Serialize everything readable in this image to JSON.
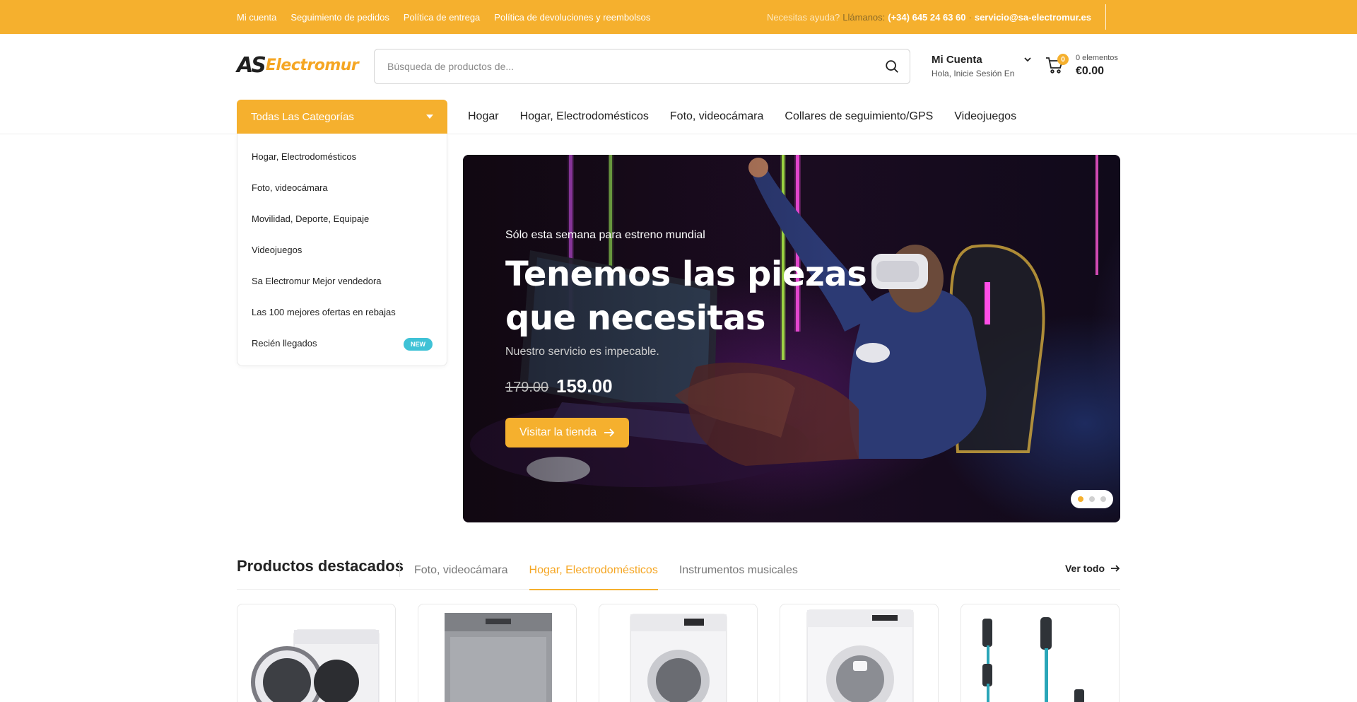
{
  "topbar": {
    "links": [
      "Mi cuenta",
      "Seguimiento de pedidos",
      "Política de entrega",
      "Política de devoluciones y reembolsos"
    ],
    "help_text": "Necesitas ayuda?",
    "call_text": "Llámanos:",
    "phone": "(+34) 645 24 63 60",
    "email": "servicio@sa-electromur.es"
  },
  "header": {
    "logo_mark": "AS",
    "logo_word": "Electromur",
    "search_placeholder": "Búsqueda de productos de...",
    "account_title": "Mi Cuenta",
    "account_sub": "Hola, Inicie Sesión En",
    "cart_count": "0",
    "cart_items": "0 elementos",
    "cart_total": "€0.00"
  },
  "nav": {
    "all_categories": "Todas Las Categorías",
    "items": [
      "Hogar",
      "Hogar, Electrodomésticos",
      "Foto, videocámara",
      "Collares de seguimiento/GPS",
      "Videojuegos"
    ]
  },
  "categories": [
    {
      "label": "Hogar, Electrodomésticos"
    },
    {
      "label": "Foto, videocámara"
    },
    {
      "label": "Movilidad, Deporte, Equipaje"
    },
    {
      "label": "Videojuegos"
    },
    {
      "label": "Sa Electromur Mejor vendedora"
    },
    {
      "label": "Las 100 mejores ofertas en rebajas"
    },
    {
      "label": "Recién llegados",
      "badge": "NEW"
    }
  ],
  "hero": {
    "pretitle": "Sólo esta semana para estreno mundial",
    "title": "Tenemos las piezas que necesitas",
    "subtitle": "Nuestro servicio es impecable.",
    "old_price": "179.00",
    "new_price": "159.00",
    "cta": "Visitar la tienda",
    "slides": 3,
    "active_slide": 1
  },
  "featured": {
    "title": "Productos destacados",
    "tabs": [
      "Foto, videocámara",
      "Hogar, Electrodomésticos",
      "Instrumentos musicales"
    ],
    "active_tab": 1,
    "see_all": "Ver todo",
    "products": [
      "washing-machine-open",
      "dishwasher",
      "washing-machine",
      "washing-machine-white",
      "stick-vacuum"
    ]
  },
  "colors": {
    "accent": "#f5b02e",
    "badge_new": "#3fc2d6"
  }
}
